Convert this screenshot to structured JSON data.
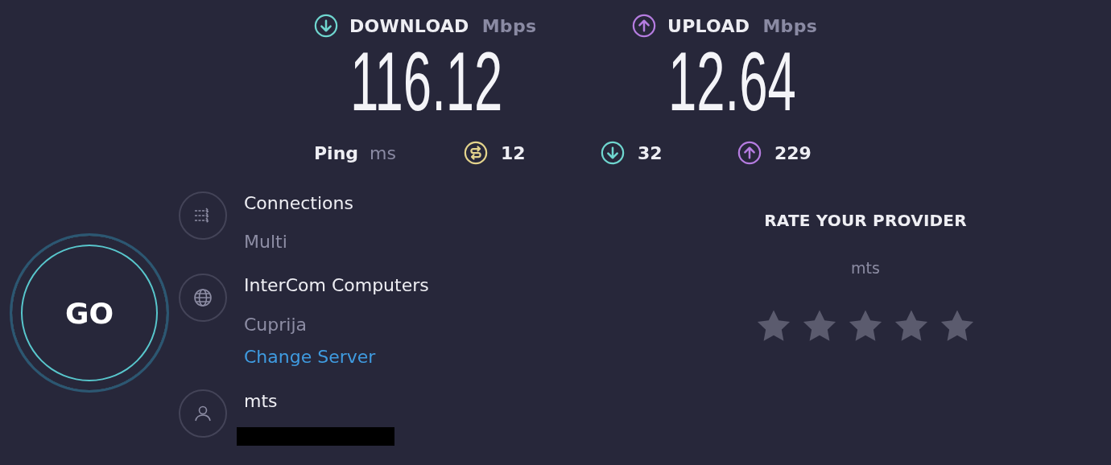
{
  "download": {
    "label": "DOWNLOAD",
    "unit": "Mbps",
    "value": "116.12"
  },
  "upload": {
    "label": "UPLOAD",
    "unit": "Mbps",
    "value": "12.64"
  },
  "ping": {
    "label": "Ping",
    "unit": "ms",
    "readings": [
      {
        "kind": "idle",
        "value": "12",
        "color": "#e3d38c"
      },
      {
        "kind": "download",
        "value": "32",
        "color": "#6fd6cf"
      },
      {
        "kind": "upload",
        "value": "229",
        "color": "#b57ce0"
      }
    ]
  },
  "go_button": {
    "label": "GO"
  },
  "connections": {
    "label": "Connections",
    "value": "Multi"
  },
  "server": {
    "name": "InterCom Computers",
    "location": "Cuprija",
    "link": "Change Server"
  },
  "provider": {
    "name": "mts",
    "redacted": true
  },
  "rating": {
    "title": "RATE YOUR PROVIDER",
    "provider": "mts",
    "stars": 0
  }
}
